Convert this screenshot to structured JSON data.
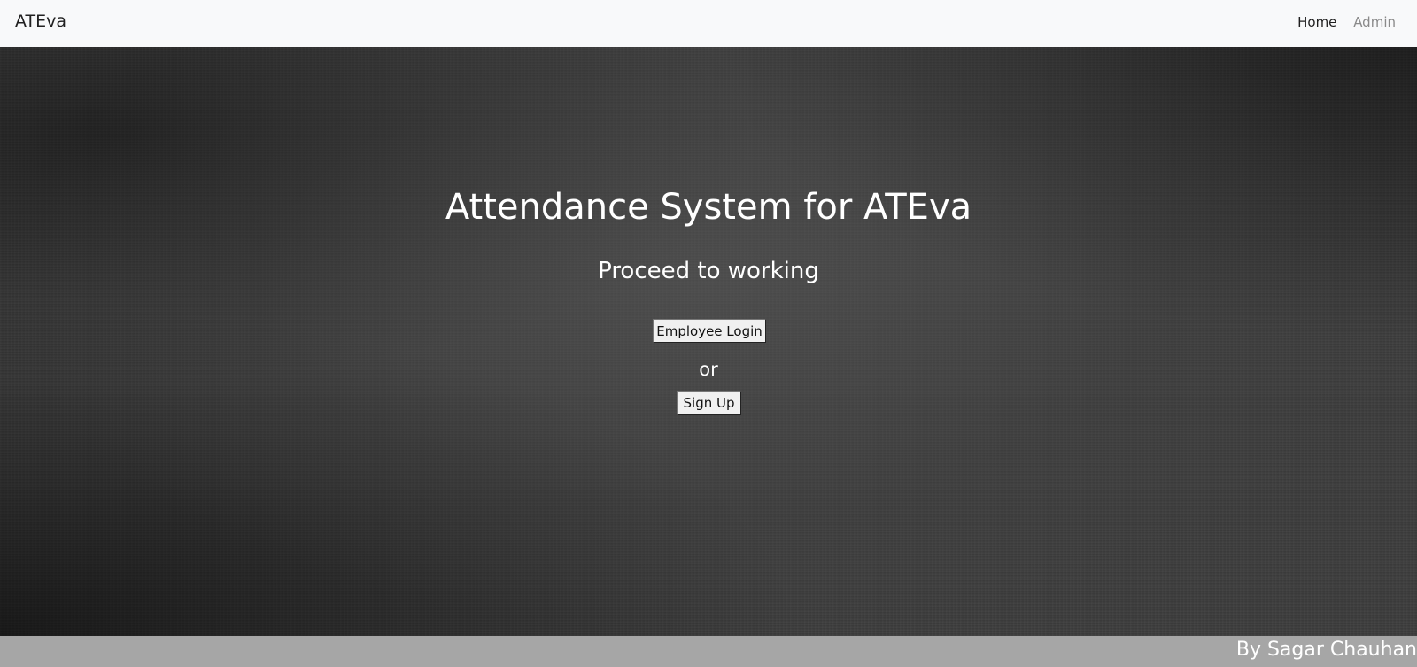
{
  "navbar": {
    "brand": "ATEva",
    "links": [
      {
        "label": "Home"
      },
      {
        "label": "Admin"
      }
    ]
  },
  "hero": {
    "title": "Attendance System for ATEva",
    "subtitle": "Proceed to working",
    "login_button": "Employee Login",
    "or_text": "or",
    "signup_button": "Sign Up"
  },
  "footer": {
    "credit": "By Sagar Chauhan"
  },
  "colors": {
    "navbar_bg": "#f8f9fa",
    "hero_bg": "#3d3d3d",
    "footer_bg": "#a6a6a6",
    "text_light": "#ffffff"
  }
}
